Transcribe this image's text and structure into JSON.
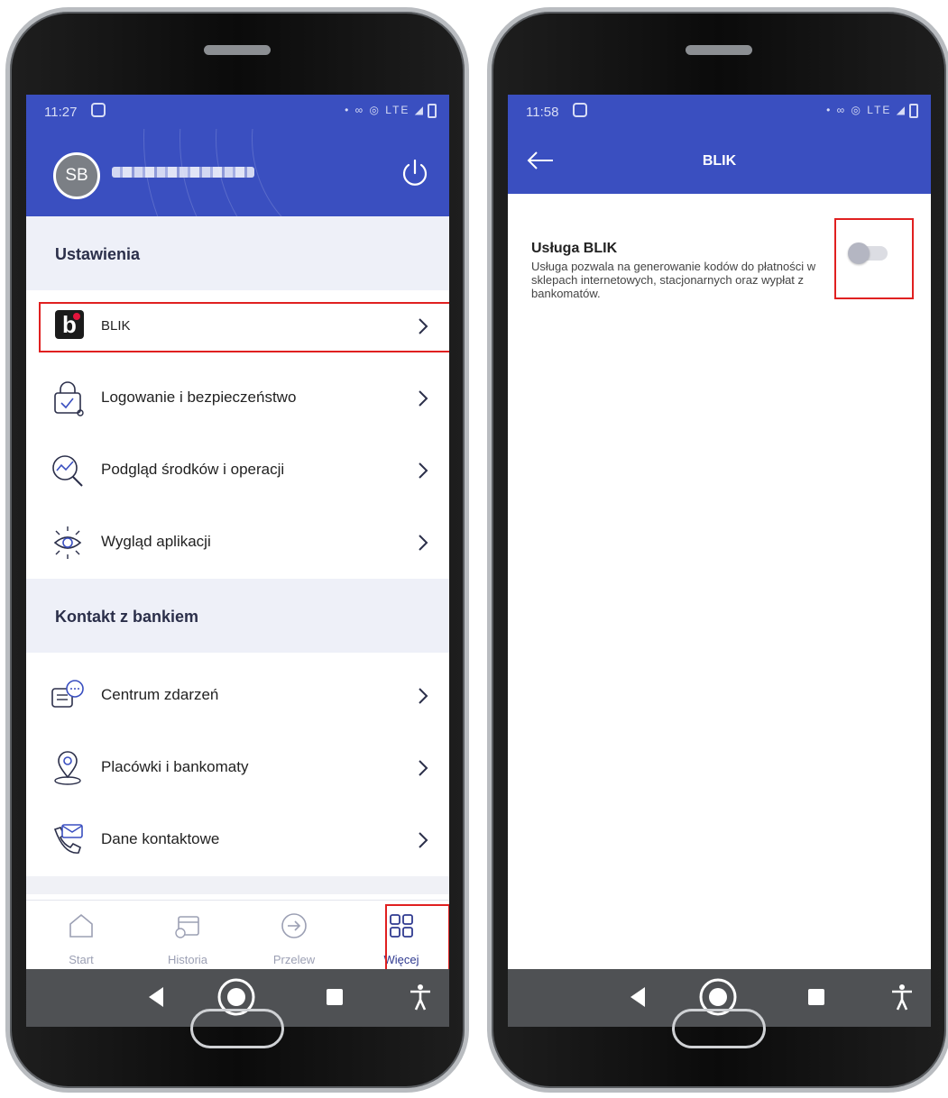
{
  "left_screen": {
    "status": {
      "time": "11:27",
      "icons": "• ∞ ◎ LTE ◢"
    },
    "profile": {
      "initials": "SB"
    },
    "sections": {
      "settings": "Ustawienia",
      "contact": "Kontakt z bankiem"
    },
    "settings_items": [
      {
        "label": "BLIK",
        "icon": "blik-logo-icon"
      },
      {
        "label": "Logowanie i bezpieczeństwo",
        "icon": "lock-key-icon"
      },
      {
        "label": "Podgląd środków i operacji",
        "icon": "magnifier-chart-icon"
      },
      {
        "label": "Wygląd aplikacji",
        "icon": "eye-sun-icon"
      }
    ],
    "contact_items": [
      {
        "label": "Centrum zdarzeń",
        "icon": "chat-bubbles-icon"
      },
      {
        "label": "Placówki i bankomaty",
        "icon": "location-pin-icon"
      },
      {
        "label": "Dane kontaktowe",
        "icon": "phone-envelope-icon"
      }
    ],
    "bottom_nav": [
      {
        "label": "Start",
        "icon": "home-icon"
      },
      {
        "label": "Historia",
        "icon": "calendar-clock-icon"
      },
      {
        "label": "Przelew",
        "icon": "arrow-circle-icon"
      },
      {
        "label": "Więcej",
        "icon": "grid-icon",
        "active": true
      }
    ]
  },
  "right_screen": {
    "status": {
      "time": "11:58",
      "icons": "• ∞ ◎ LTE ◢"
    },
    "toolbar": {
      "title": "BLIK"
    },
    "setting": {
      "title": "Usługa BLIK",
      "description": "Usługa pozwala na generowanie kodów do płatności w sklepach internetowych, stacjonarnych oraz wypłat z bankomatów.",
      "enabled": false
    }
  },
  "colors": {
    "brand_blue": "#3a4fc0",
    "highlight_red": "#e02020",
    "section_bg": "#eef0f8",
    "nav_active": "#2f3a90",
    "android_bar": "#4f5154"
  }
}
